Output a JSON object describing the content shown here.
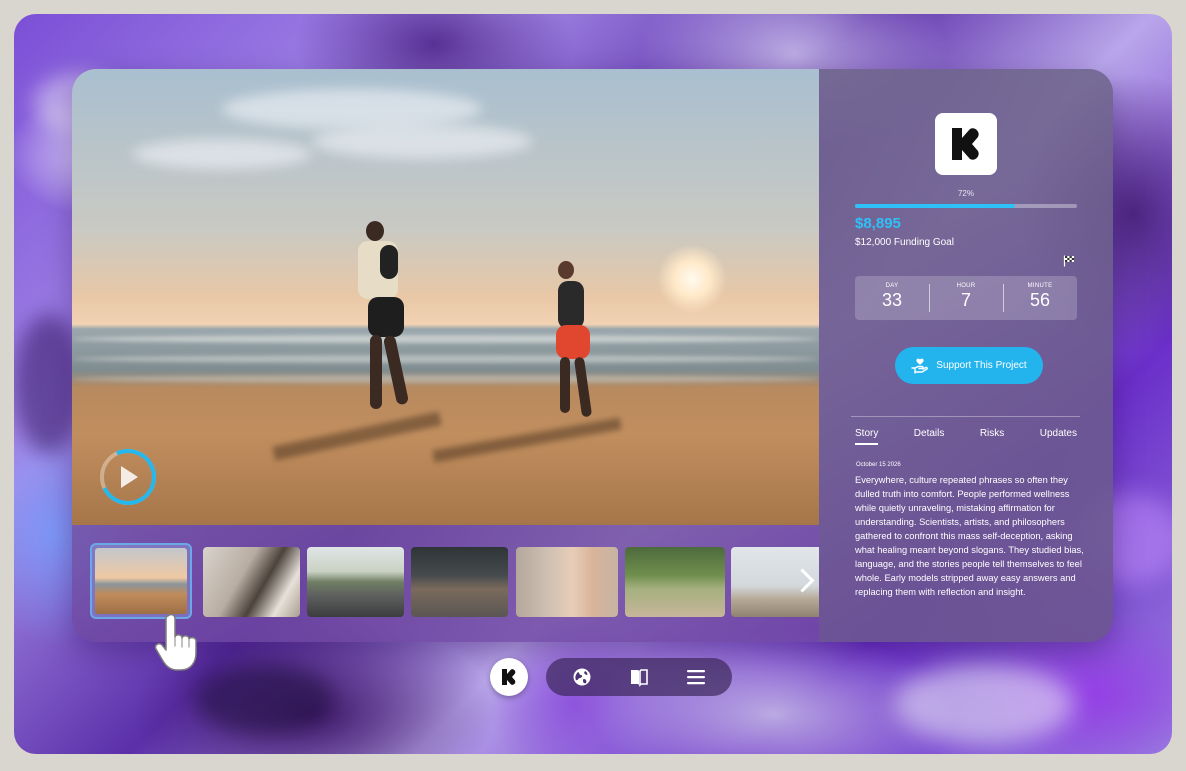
{
  "campaign": {
    "progress_percent": 72,
    "progress_label": "72%",
    "amount_raised": "$8,895",
    "funding_goal": "$12,000 Funding Goal"
  },
  "countdown": [
    {
      "label": "DAY",
      "value": "33"
    },
    {
      "label": "HOUR",
      "value": "7"
    },
    {
      "label": "MINUTE",
      "value": "56"
    }
  ],
  "actions": {
    "support_label": "Support This Project"
  },
  "tabs": [
    {
      "label": "Story",
      "active": true
    },
    {
      "label": "Details",
      "active": false
    },
    {
      "label": "Risks",
      "active": false
    },
    {
      "label": "Updates",
      "active": false
    }
  ],
  "story": {
    "date": "October 15 2026",
    "body": "Everywhere, culture repeated phrases so often they dulled truth into comfort. People performed wellness while quietly unraveling, mistaking affirmation for understanding. Scientists, artists, and philosophers gathered to confront this mass self-deception, asking what healing meant beyond slogans. They studied bias, language, and the stories people tell themselves to feel whole. Early models stripped away easy answers and replacing them with reflection and insight."
  },
  "gallery": {
    "thumbnails": [
      {
        "icon": "beach-runners-photo",
        "active": true
      },
      {
        "icon": "climbing-wall-photo",
        "active": false
      },
      {
        "icon": "cyclist-photo",
        "active": false
      },
      {
        "icon": "sprinter-start-photo",
        "active": false
      },
      {
        "icon": "yoga-hands-photo",
        "active": false
      },
      {
        "icon": "outdoor-yoga-photo",
        "active": false
      },
      {
        "icon": "beach-jump-photo",
        "active": false
      }
    ]
  },
  "colors": {
    "accent": "#23b4ee",
    "raised": "#2ec1f7",
    "active_thumb_border": "#6aa8e8"
  },
  "dock": {
    "items": [
      "kickstarter-logo-icon",
      "globe-icon",
      "book-icon",
      "menu-icon"
    ]
  }
}
